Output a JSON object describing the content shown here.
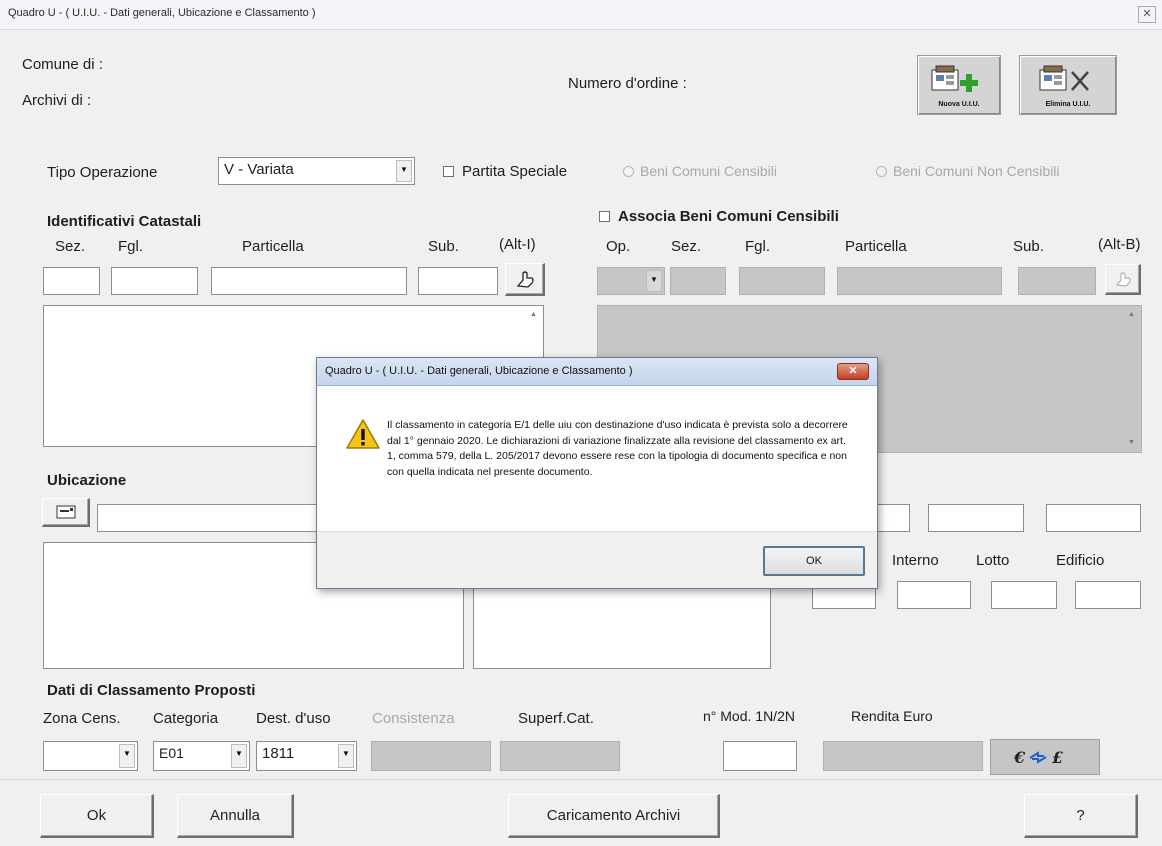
{
  "window": {
    "title": "Quadro U - ( U.I.U. - Dati generali, Ubicazione e Classamento )",
    "close_glyph": "✕"
  },
  "header": {
    "comune_label": "Comune di  :",
    "archivi_label": "Archivi di   :",
    "numero_ordine_label": "Numero d'ordine :",
    "nuova_uiu_label": "Nuova U.I.U.",
    "elimina_uiu_label": "Elimina U.I.U."
  },
  "operation": {
    "tipo_label": "Tipo Operazione",
    "tipo_value": "V - Variata",
    "partita_speciale_label": "Partita Speciale",
    "beni_censibili_label": "Beni Comuni Censibili",
    "beni_non_censibili_label": "Beni Comuni Non Censibili"
  },
  "identificativi": {
    "title": "Identificativi Catastali",
    "sez_label": "Sez.",
    "fgl_label": "Fgl.",
    "particella_label": "Particella",
    "sub_label": "Sub.",
    "shortcut_label": "(Alt-I)"
  },
  "associa": {
    "title": "Associa Beni Comuni Censibili",
    "op_label": "Op.",
    "sez_label": "Sez.",
    "fgl_label": "Fgl.",
    "particella_label": "Particella",
    "sub_label": "Sub.",
    "shortcut_label": "(Alt-B)"
  },
  "ubicazione": {
    "title": "Ubicazione",
    "interno_label": "Interno",
    "lotto_label": "Lotto",
    "edificio_label": "Edificio"
  },
  "classamento": {
    "title": "Dati di Classamento Proposti",
    "zona_label": "Zona Cens.",
    "categoria_label": "Categoria",
    "categoria_value": "E01",
    "dest_label": "Dest. d'uso",
    "dest_value": "1811",
    "consistenza_label": "Consistenza",
    "superf_label": "Superf.Cat.",
    "mod_label": "n° Mod. 1N/2N",
    "rendita_label": "Rendita  Euro"
  },
  "buttons": {
    "ok": "Ok",
    "annulla": "Annulla",
    "caricamento": "Caricamento Archivi",
    "help": "?"
  },
  "dialog": {
    "title": "Quadro U - ( U.I.U. - Dati generali, Ubicazione e Classamento )",
    "message": "Il classamento in categoria E/1 delle uiu con destinazione d'uso indicata è prevista solo a decorrere dal 1° gennaio 2020. Le dichiarazioni di variazione finalizzate alla revisione del classamento ex art. 1, comma 579, della L. 205/2017 devono essere rese con la tipologia di documento specifica e non con quella indicata nel presente documento.",
    "ok_label": "OK",
    "close_glyph": "✕"
  },
  "icons": {
    "warning": "warning-icon",
    "pick": "pick-hand-icon",
    "currency": "currency-convert-icon"
  }
}
